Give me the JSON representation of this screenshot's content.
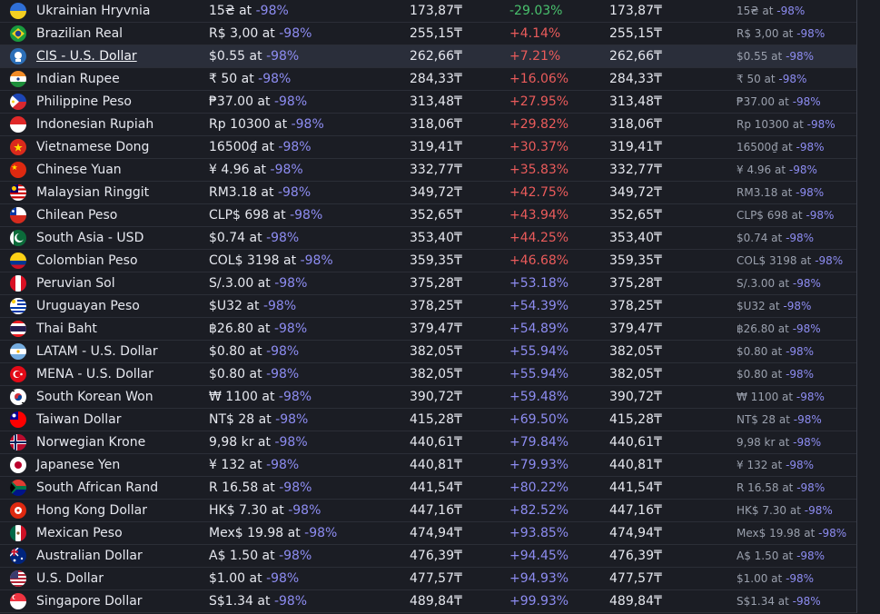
{
  "table": {
    "rows": [
      {
        "flag": "ua",
        "name": "Ukrainian Hryvnia",
        "price": "15₴ at",
        "discount": "-98%",
        "converted": "173,87₸",
        "diff": "-29.03%",
        "diff_class": "neg",
        "converted2": "173,87₸",
        "price2": "15₴ at",
        "discount2": "-98%"
      },
      {
        "flag": "br",
        "name": "Brazilian Real",
        "price": "R$ 3,00 at",
        "discount": "-98%",
        "converted": "255,15₸",
        "diff": "+4.14%",
        "diff_class": "pos-red",
        "converted2": "255,15₸",
        "price2": "R$ 3,00 at",
        "discount2": "-98%"
      },
      {
        "flag": "cis",
        "name": "CIS - U.S. Dollar",
        "price": "$0.55 at",
        "discount": "-98%",
        "converted": "262,66₸",
        "diff": "+7.21%",
        "diff_class": "pos-red",
        "converted2": "262,66₸",
        "price2": "$0.55 at",
        "discount2": "-98%"
      },
      {
        "flag": "in",
        "name": "Indian Rupee",
        "price": "₹ 50 at",
        "discount": "-98%",
        "converted": "284,33₸",
        "diff": "+16.06%",
        "diff_class": "pos-red",
        "converted2": "284,33₸",
        "price2": "₹ 50 at",
        "discount2": "-98%"
      },
      {
        "flag": "ph",
        "name": "Philippine Peso",
        "price": "₱37.00 at",
        "discount": "-98%",
        "converted": "313,48₸",
        "diff": "+27.95%",
        "diff_class": "pos-red",
        "converted2": "313,48₸",
        "price2": "₱37.00 at",
        "discount2": "-98%"
      },
      {
        "flag": "id",
        "name": "Indonesian Rupiah",
        "price": "Rp 10300 at",
        "discount": "-98%",
        "converted": "318,06₸",
        "diff": "+29.82%",
        "diff_class": "pos-red",
        "converted2": "318,06₸",
        "price2": "Rp 10300 at",
        "discount2": "-98%"
      },
      {
        "flag": "vn",
        "name": "Vietnamese Dong",
        "price": "16500₫ at",
        "discount": "-98%",
        "converted": "319,41₸",
        "diff": "+30.37%",
        "diff_class": "pos-red",
        "converted2": "319,41₸",
        "price2": "16500₫ at",
        "discount2": "-98%"
      },
      {
        "flag": "cn",
        "name": "Chinese Yuan",
        "price": "¥ 4.96 at",
        "discount": "-98%",
        "converted": "332,77₸",
        "diff": "+35.83%",
        "diff_class": "pos-red",
        "converted2": "332,77₸",
        "price2": "¥ 4.96 at",
        "discount2": "-98%"
      },
      {
        "flag": "my",
        "name": "Malaysian Ringgit",
        "price": "RM3.18 at",
        "discount": "-98%",
        "converted": "349,72₸",
        "diff": "+42.75%",
        "diff_class": "pos-red",
        "converted2": "349,72₸",
        "price2": "RM3.18 at",
        "discount2": "-98%"
      },
      {
        "flag": "cl",
        "name": "Chilean Peso",
        "price": "CLP$ 698 at",
        "discount": "-98%",
        "converted": "352,65₸",
        "diff": "+43.94%",
        "diff_class": "pos-red",
        "converted2": "352,65₸",
        "price2": "CLP$ 698 at",
        "discount2": "-98%"
      },
      {
        "flag": "sa",
        "name": "South Asia - USD",
        "price": "$0.74 at",
        "discount": "-98%",
        "converted": "353,40₸",
        "diff": "+44.25%",
        "diff_class": "pos-red",
        "converted2": "353,40₸",
        "price2": "$0.74 at",
        "discount2": "-98%"
      },
      {
        "flag": "co",
        "name": "Colombian Peso",
        "price": "COL$ 3198 at",
        "discount": "-98%",
        "converted": "359,35₸",
        "diff": "+46.68%",
        "diff_class": "pos-red",
        "converted2": "359,35₸",
        "price2": "COL$ 3198 at",
        "discount2": "-98%"
      },
      {
        "flag": "pe",
        "name": "Peruvian Sol",
        "price": "S/.3.00 at",
        "discount": "-98%",
        "converted": "375,28₸",
        "diff": "+53.18%",
        "diff_class": "pos-blue",
        "converted2": "375,28₸",
        "price2": "S/.3.00 at",
        "discount2": "-98%"
      },
      {
        "flag": "uy",
        "name": "Uruguayan Peso",
        "price": "$U32 at",
        "discount": "-98%",
        "converted": "378,25₸",
        "diff": "+54.39%",
        "diff_class": "pos-blue",
        "converted2": "378,25₸",
        "price2": "$U32 at",
        "discount2": "-98%"
      },
      {
        "flag": "th",
        "name": "Thai Baht",
        "price": "฿26.80 at",
        "discount": "-98%",
        "converted": "379,47₸",
        "diff": "+54.89%",
        "diff_class": "pos-blue",
        "converted2": "379,47₸",
        "price2": "฿26.80 at",
        "discount2": "-98%"
      },
      {
        "flag": "ar",
        "name": "LATAM - U.S. Dollar",
        "price": "$0.80 at",
        "discount": "-98%",
        "converted": "382,05₸",
        "diff": "+55.94%",
        "diff_class": "pos-blue",
        "converted2": "382,05₸",
        "price2": "$0.80 at",
        "discount2": "-98%"
      },
      {
        "flag": "tr",
        "name": "MENA - U.S. Dollar",
        "price": "$0.80 at",
        "discount": "-98%",
        "converted": "382,05₸",
        "diff": "+55.94%",
        "diff_class": "pos-blue",
        "converted2": "382,05₸",
        "price2": "$0.80 at",
        "discount2": "-98%"
      },
      {
        "flag": "kr",
        "name": "South Korean Won",
        "price": "₩ 1100 at",
        "discount": "-98%",
        "converted": "390,72₸",
        "diff": "+59.48%",
        "diff_class": "pos-blue",
        "converted2": "390,72₸",
        "price2": "₩ 1100 at",
        "discount2": "-98%"
      },
      {
        "flag": "tw",
        "name": "Taiwan Dollar",
        "price": "NT$ 28 at",
        "discount": "-98%",
        "converted": "415,28₸",
        "diff": "+69.50%",
        "diff_class": "pos-blue",
        "converted2": "415,28₸",
        "price2": "NT$ 28 at",
        "discount2": "-98%"
      },
      {
        "flag": "no",
        "name": "Norwegian Krone",
        "price": "9,98 kr at",
        "discount": "-98%",
        "converted": "440,61₸",
        "diff": "+79.84%",
        "diff_class": "pos-blue",
        "converted2": "440,61₸",
        "price2": "9,98 kr at",
        "discount2": "-98%"
      },
      {
        "flag": "jp",
        "name": "Japanese Yen",
        "price": "¥ 132 at",
        "discount": "-98%",
        "converted": "440,81₸",
        "diff": "+79.93%",
        "diff_class": "pos-blue",
        "converted2": "440,81₸",
        "price2": "¥ 132 at",
        "discount2": "-98%"
      },
      {
        "flag": "za",
        "name": "South African Rand",
        "price": "R 16.58 at",
        "discount": "-98%",
        "converted": "441,54₸",
        "diff": "+80.22%",
        "diff_class": "pos-blue",
        "converted2": "441,54₸",
        "price2": "R 16.58 at",
        "discount2": "-98%"
      },
      {
        "flag": "hk",
        "name": "Hong Kong Dollar",
        "price": "HK$ 7.30 at",
        "discount": "-98%",
        "converted": "447,16₸",
        "diff": "+82.52%",
        "diff_class": "pos-blue",
        "converted2": "447,16₸",
        "price2": "HK$ 7.30 at",
        "discount2": "-98%"
      },
      {
        "flag": "mx",
        "name": "Mexican Peso",
        "price": "Mex$ 19.98 at",
        "discount": "-98%",
        "converted": "474,94₸",
        "diff": "+93.85%",
        "diff_class": "pos-blue",
        "converted2": "474,94₸",
        "price2": "Mex$ 19.98 at",
        "discount2": "-98%"
      },
      {
        "flag": "au",
        "name": "Australian Dollar",
        "price": "A$ 1.50 at",
        "discount": "-98%",
        "converted": "476,39₸",
        "diff": "+94.45%",
        "diff_class": "pos-blue",
        "converted2": "476,39₸",
        "price2": "A$ 1.50 at",
        "discount2": "-98%"
      },
      {
        "flag": "us",
        "name": "U.S. Dollar",
        "price": "$1.00 at",
        "discount": "-98%",
        "converted": "477,57₸",
        "diff": "+94.93%",
        "diff_class": "pos-blue",
        "converted2": "477,57₸",
        "price2": "$1.00 at",
        "discount2": "-98%"
      },
      {
        "flag": "sg",
        "name": "Singapore Dollar",
        "price": "S$1.34 at",
        "discount": "-98%",
        "converted": "489,84₸",
        "diff": "+99.93%",
        "diff_class": "pos-blue",
        "converted2": "489,84₸",
        "price2": "S$1.34 at",
        "discount2": "-98%"
      }
    ],
    "highlighted_row": 2,
    "colors": {
      "background": "#1b1d24",
      "negative": "#49c16d",
      "positive_high": "#ea5b5b",
      "positive": "#8d8cf1",
      "discount": "#8d8cf1"
    }
  }
}
